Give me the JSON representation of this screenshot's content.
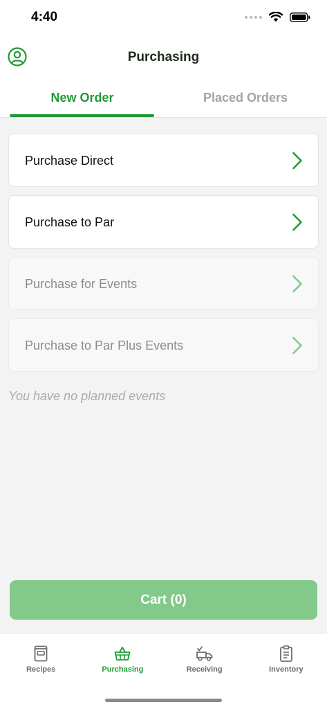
{
  "status_bar": {
    "time": "4:40"
  },
  "header": {
    "title": "Purchasing",
    "tabs": [
      {
        "label": "New Order",
        "active": true
      },
      {
        "label": "Placed Orders",
        "active": false
      }
    ]
  },
  "options": [
    {
      "label": "Purchase Direct",
      "enabled": true
    },
    {
      "label": "Purchase to Par",
      "enabled": true
    },
    {
      "label": "Purchase for Events",
      "enabled": false
    },
    {
      "label": "Purchase to Par Plus Events",
      "enabled": false
    }
  ],
  "empty_note": "You have no planned events",
  "cart_button": {
    "label": "Cart (0)"
  },
  "tab_bar": {
    "items": [
      {
        "label": "Recipes",
        "icon": "recipe-book-icon",
        "active": false
      },
      {
        "label": "Purchasing",
        "icon": "basket-icon",
        "active": true
      },
      {
        "label": "Receiving",
        "icon": "delivery-truck-icon",
        "active": false
      },
      {
        "label": "Inventory",
        "icon": "clipboard-icon",
        "active": false
      }
    ]
  },
  "colors": {
    "accent": "#1e9b33",
    "accent_light": "#82c98a",
    "inactive": "#a3a3a3"
  }
}
